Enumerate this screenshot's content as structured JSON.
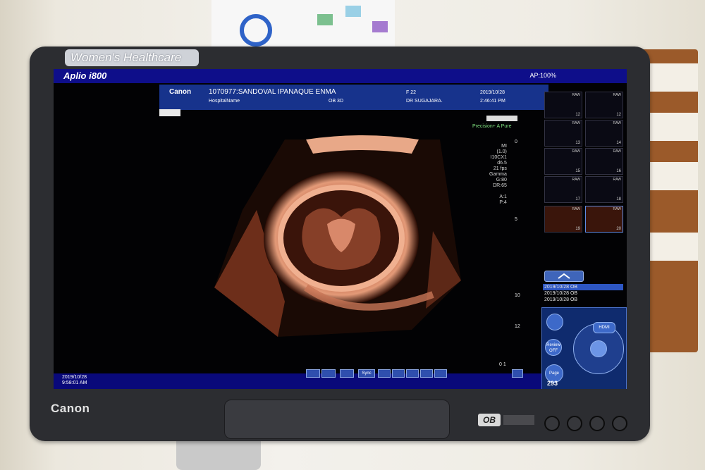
{
  "sticker": {
    "text": "Women's Healthcare"
  },
  "app": {
    "brand": "Aplio i800",
    "ap": "AP:100%"
  },
  "patient": {
    "maker": "Canon",
    "id_name": "1070977:SANDOVAL IPANAQUE ENMA",
    "hospital": "HospitalName",
    "sex_age": "F  22",
    "exam": "OB 3D",
    "date": "2019/10/28",
    "time": "2:46:41 PM",
    "doctor": "DR SUGAJARA."
  },
  "image": {
    "precision": "Precision+",
    "apure": "A Pure",
    "params": "MI\n(1.0)\nI10CX1\nd6.5\n21 fps\nGamma\nG:80\nDR:65\n\nA:1\nP:4",
    "depth_labels": [
      "0",
      "5",
      "10",
      "12"
    ],
    "bottom_label": "0 1"
  },
  "thumbnails": [
    {
      "num": "12",
      "raw": "RAW"
    },
    {
      "num": "12",
      "raw": "RAW"
    },
    {
      "num": "13",
      "raw": "RAW"
    },
    {
      "num": "14",
      "raw": "RAW"
    },
    {
      "num": "15",
      "raw": "RAW"
    },
    {
      "num": "16",
      "raw": "RAW"
    },
    {
      "num": "17",
      "raw": "RAW"
    },
    {
      "num": "18",
      "raw": "RAW"
    },
    {
      "num": "19",
      "raw": "RAW"
    },
    {
      "num": "20",
      "raw": "RAW"
    }
  ],
  "study_list": [
    "2019/10/28  OB",
    "2019/10/28  OB",
    "2019/10/28  OB"
  ],
  "touch": {
    "hdmi": "HDMI",
    "review": "Review OFF",
    "page": "Page"
  },
  "toolbar": {
    "sync": "Sync"
  },
  "status": {
    "date": "2019/10/28",
    "time": "9:58:01 AM",
    "storage": "293",
    "fps": "fps"
  },
  "bezel": {
    "brand": "Canon",
    "mode": "OB"
  },
  "colors": {
    "accent": "#0e0e8a",
    "header": "#17338c",
    "image_tint": "#d87a52"
  }
}
